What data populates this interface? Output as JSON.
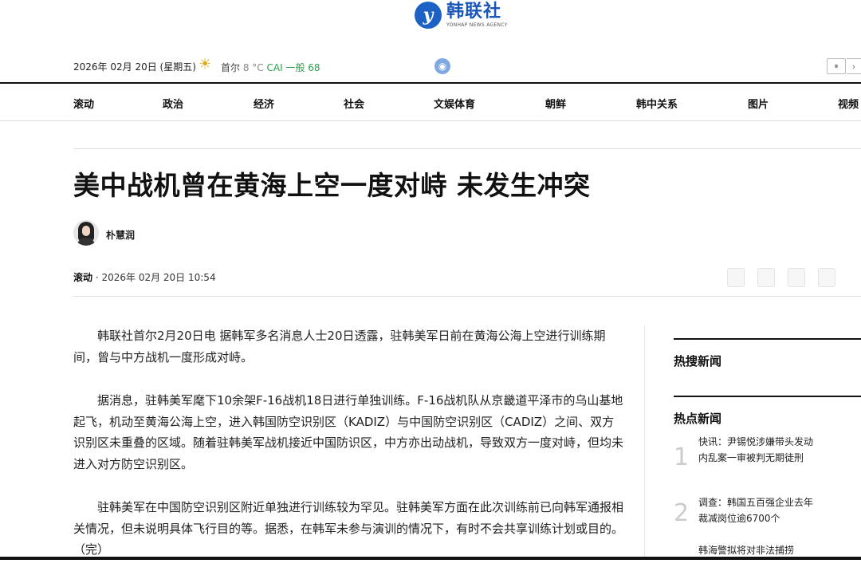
{
  "brand": {
    "logo_mark": "y",
    "name": "韩联社",
    "name_en": "YONHAP NEWS AGENCY"
  },
  "topbar": {
    "date": "2026年 02月 20日 (星期五)",
    "weather_icon": "sun-icon",
    "city": "首尔",
    "temp": "8 °C",
    "cai": "CAI 一般 68",
    "pause": "⏸",
    "next": "›"
  },
  "nav": [
    "滚动",
    "政治",
    "经济",
    "社会",
    "文娱体育",
    "朝鲜",
    "韩中关系",
    "图片",
    "视频"
  ],
  "article": {
    "title": "美中战机曾在黄海上空一度对峙 未发生冲突",
    "author": "朴慧润",
    "category": "滚动",
    "datetime": "· 2026年 02月 20日 10:54",
    "paragraphs": [
      "韩联社首尔2月20日电 据韩军多名消息人士20日透露，驻韩美军日前在黄海公海上空进行训练期间，曾与中方战机一度形成对峙。",
      "据消息，驻韩美军麾下10余架F-16战机18日进行单独训练。F-16战机队从京畿道平泽市的乌山基地起飞，机动至黄海公海上空，进入韩国防空识别区（KADIZ）与中国防空识别区（CADIZ）之间、双方识别区未重叠的区域。随着驻韩美军战机接近中国防识区，中方亦出动战机，导致双方一度对峙，但均未进入对方防空识别区。",
      "驻韩美军在中国防空识别区附近单独进行训练较为罕见。驻韩美军方面在此次训练前已向韩军通报相关情况，但未说明具体飞行目的等。据悉，在韩军未参与演训的情况下，有时不会共享训练计划或目的。（完）"
    ]
  },
  "sidebar": {
    "search_title": "热搜新闻",
    "hot_title": "热点新闻",
    "hot_items": [
      {
        "num": "1",
        "text": "快讯：尹锡悦涉嫌带头发动内乱案一审被判无期徒刑"
      },
      {
        "num": "2",
        "text": "调查：韩国五百强企业去年裁减岗位逾6700个"
      },
      {
        "num": "",
        "text": "韩海警拟将对非法捕捞"
      }
    ]
  }
}
